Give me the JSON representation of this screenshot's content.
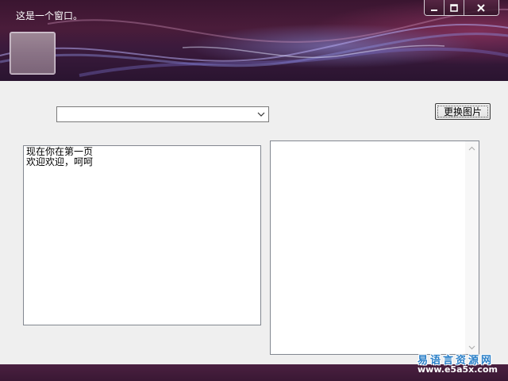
{
  "window": {
    "title": "这是一个窗口。",
    "controls": {
      "minimize_icon": "minimize-icon",
      "maximize_icon": "maximize-icon",
      "close_icon": "close-icon"
    }
  },
  "combo": {
    "value": "",
    "arrow_icon": "chevron-down-icon"
  },
  "toolbar": {
    "change_image_label": "更换图片"
  },
  "textbox": {
    "lines": [
      "现在你在第一页",
      "欢迎欢迎，呵呵"
    ]
  },
  "picture_box": {
    "scroll_up_icon": "chevron-up-icon",
    "scroll_down_icon": "chevron-down-icon"
  },
  "watermark": {
    "chinese": "易语言资源网",
    "url": "www.e5a5x.com"
  },
  "colors": {
    "header_dark": "#3a1530",
    "header_accent": "#8c8cdc",
    "bottom_bar": "#3a1834",
    "background": "#efefef",
    "watermark_blue": "#2a7fc8"
  }
}
